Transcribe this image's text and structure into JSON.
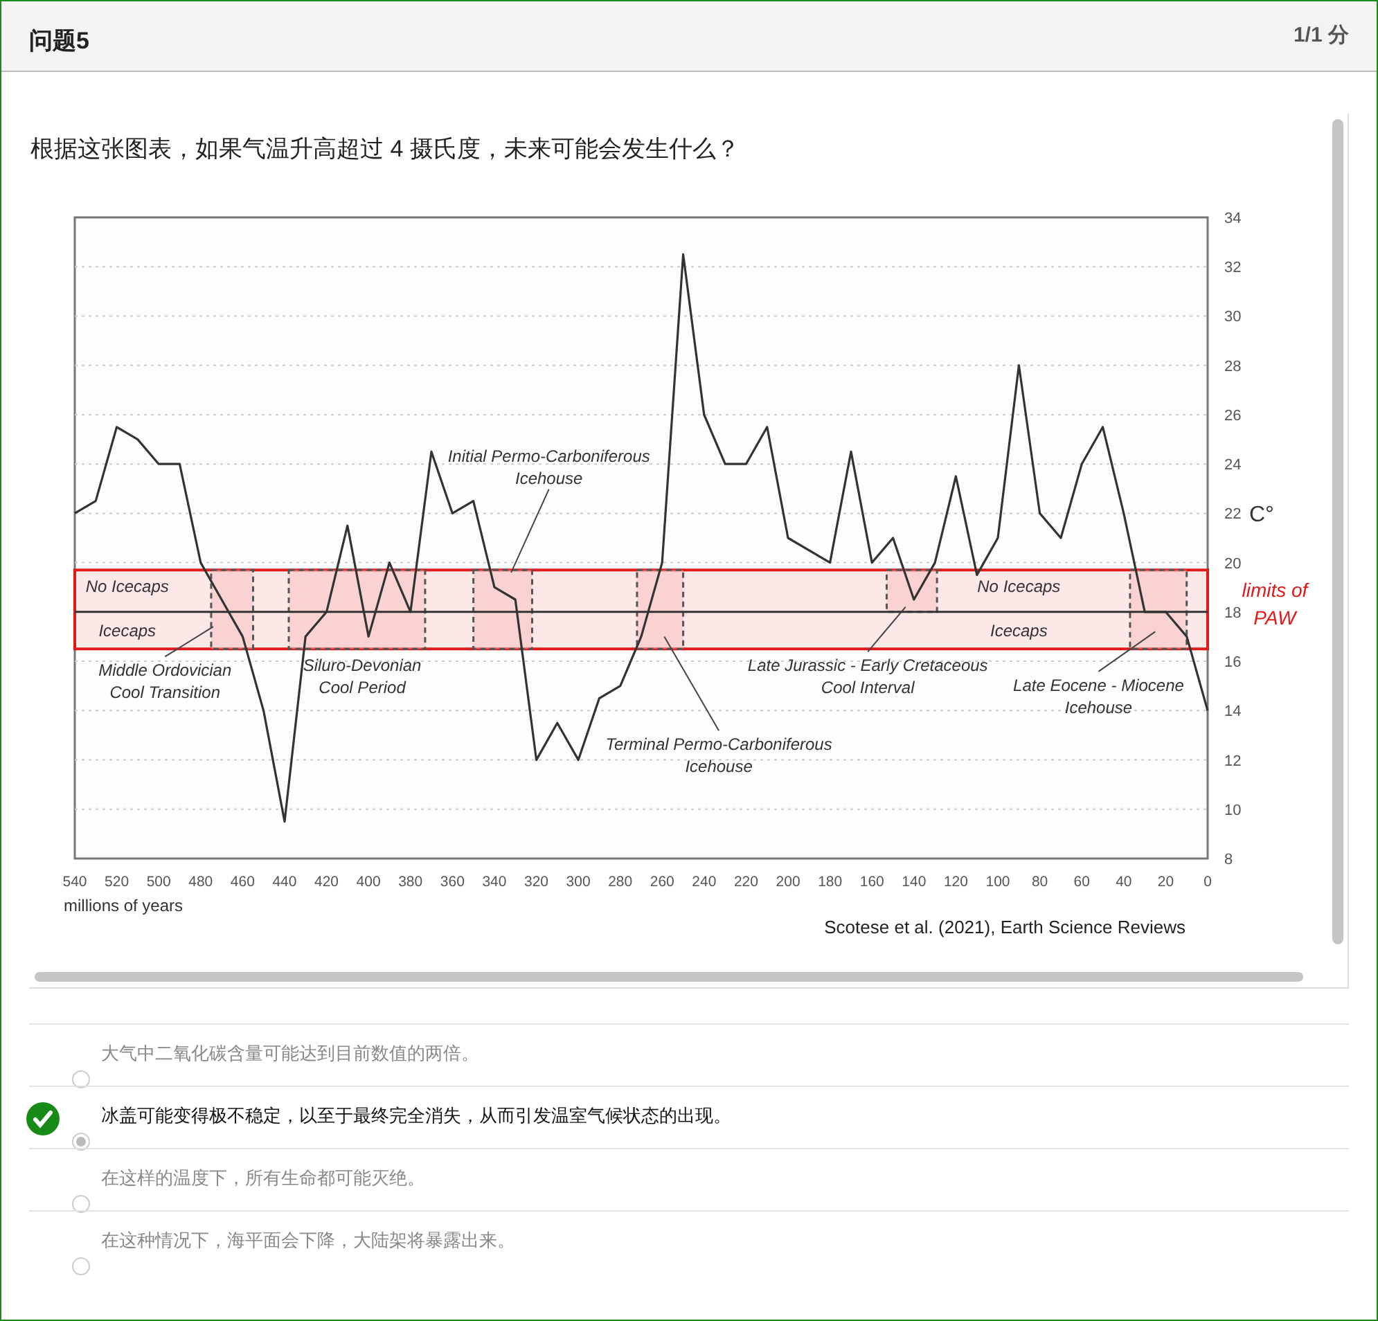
{
  "header": {
    "title": "问题5",
    "score": "1/1 分"
  },
  "question": {
    "text": "根据这张图表，如果气温升高超过 4 摄氏度，未来可能会发生什么？",
    "figure": {
      "credit": "Scotese et al. (2021), Earth Science Reviews",
      "chart_data": {
        "type": "line",
        "xlabel": "millions of years",
        "ylabel": "C°",
        "x": [
          540,
          530,
          520,
          510,
          500,
          490,
          480,
          470,
          460,
          450,
          440,
          430,
          420,
          410,
          400,
          390,
          380,
          370,
          360,
          350,
          340,
          330,
          320,
          310,
          300,
          290,
          280,
          270,
          260,
          250,
          240,
          230,
          220,
          210,
          200,
          190,
          180,
          170,
          160,
          150,
          140,
          130,
          120,
          110,
          100,
          90,
          80,
          70,
          60,
          50,
          40,
          30,
          20,
          10,
          0
        ],
        "series": [
          {
            "color": "#333333",
            "values": [
              22,
              22.5,
              25.5,
              25,
              24,
              24,
              20,
              18.5,
              17,
              14,
              9.5,
              17,
              18,
              21.5,
              17,
              20,
              18,
              24.5,
              22,
              22.5,
              19,
              18.5,
              12,
              13.5,
              12,
              14.5,
              15,
              17,
              20,
              32.5,
              26,
              24,
              24,
              25.5,
              21,
              20.5,
              20,
              24.5,
              20,
              21,
              18.5,
              20,
              23.5,
              19.5,
              21,
              28,
              22,
              21,
              24,
              25.5,
              22,
              18,
              18,
              17,
              14
            ]
          }
        ],
        "xlim": [
          540,
          0
        ],
        "ylim": [
          8,
          34
        ],
        "xticks": [
          540,
          520,
          500,
          480,
          460,
          440,
          420,
          400,
          380,
          360,
          340,
          320,
          300,
          280,
          260,
          240,
          220,
          200,
          180,
          160,
          140,
          120,
          100,
          80,
          60,
          40,
          20,
          0
        ],
        "yticks": [
          8,
          10,
          12,
          14,
          16,
          18,
          20,
          22,
          24,
          26,
          28,
          30,
          32,
          34
        ],
        "grid": true,
        "bands": [
          {
            "axis": "y",
            "from": 16.5,
            "to": 19.7
          },
          {
            "axis": "x",
            "from": 475,
            "to": 455
          },
          {
            "axis": "x",
            "from": 438,
            "to": 373
          },
          {
            "axis": "x",
            "from": 350,
            "to": 322
          },
          {
            "axis": "x",
            "from": 272,
            "to": 250
          },
          {
            "axis": "x",
            "from": 153,
            "to": 129
          },
          {
            "axis": "x",
            "from": 37,
            "to": 10
          }
        ],
        "ref_lines": [
          {
            "axis": "y",
            "value": 18
          }
        ],
        "annotations": [
          "No Icecaps",
          "Icecaps",
          "No Icecaps",
          "Icecaps",
          "Middle Ordovician\nCool Transition",
          "Siluro-Devonian\nCool Period",
          "Initial Permo-Carboniferous\nIcehouse",
          "Terminal Permo-Carboniferous\nIcehouse",
          "Late Jurassic - Early Cretaceous\nCool Interval",
          "Late Eocene - Miocene\nIcehouse",
          "limits of\nPAW"
        ]
      }
    }
  },
  "options": [
    {
      "text": "大气中二氧化碳含量可能达到目前数值的两倍。",
      "selected": false,
      "correct": false
    },
    {
      "text": "冰盖可能变得极不稳定，以至于最终完全消失，从而引发温室气候状态的出现。",
      "selected": true,
      "correct": true
    },
    {
      "text": "在这样的温度下，所有生命都可能灭绝。",
      "selected": false,
      "correct": false
    },
    {
      "text": "在这种情况下，海平面会下降，大陆架将暴露出来。",
      "selected": false,
      "correct": false
    }
  ]
}
